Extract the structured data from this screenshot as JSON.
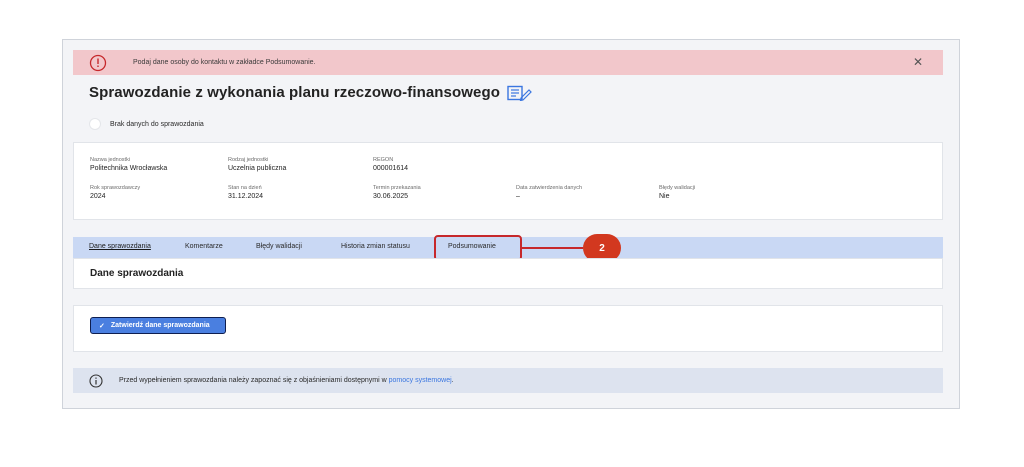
{
  "alert": {
    "message": "Podaj dane osoby do kontaktu w zakładce Podsumowanie.",
    "close_glyph": "✕",
    "icon": "error-icon",
    "color": "#f2c7cb"
  },
  "header": {
    "title": "Sprawozdanie z wykonania planu rzeczowo-finansowego",
    "edit_icon": "edit-document-icon"
  },
  "no_data_checkbox": {
    "label": "Brak danych do sprawozdania",
    "checked": false
  },
  "info": {
    "fields": [
      {
        "label": "Nazwa jednostki",
        "value": "Politechnika Wrocławska"
      },
      {
        "label": "Rodzaj jednostki",
        "value": "Uczelnia publiczna"
      },
      {
        "label": "REGON",
        "value": "000001614"
      },
      {
        "label": "Rok sprawozdawczy",
        "value": "2024"
      },
      {
        "label": "Stan na dzień",
        "value": "31.12.2024"
      },
      {
        "label": "Termin przekazania",
        "value": "30.06.2025"
      },
      {
        "label": "Data zatwierdzenia danych",
        "value": "–"
      },
      {
        "label": "Błędy walidacji",
        "value": "Nie"
      }
    ]
  },
  "tabs": [
    {
      "label": "Dane sprawozdania",
      "active": true
    },
    {
      "label": "Komentarze",
      "active": false
    },
    {
      "label": "Błędy walidacji",
      "active": false
    },
    {
      "label": "Historia zmian statusu",
      "active": false
    },
    {
      "label": "Podsumowanie",
      "active": false,
      "highlighted": true
    }
  ],
  "callout": {
    "number": "2",
    "color": "#d2381f"
  },
  "section": {
    "title": "Dane sprawozdania"
  },
  "actions": {
    "confirm_label": "Zatwierdź dane sprawozdania",
    "confirm_icon": "check-icon",
    "accent": "#4a7fe0"
  },
  "notice": {
    "text_before": "Przed wypełnieniem sprawozdania należy zapoznać się z objaśnieniami dostępnymi w ",
    "link_text": "pomocy systemowej",
    "text_after": ".",
    "icon": "info-icon"
  }
}
